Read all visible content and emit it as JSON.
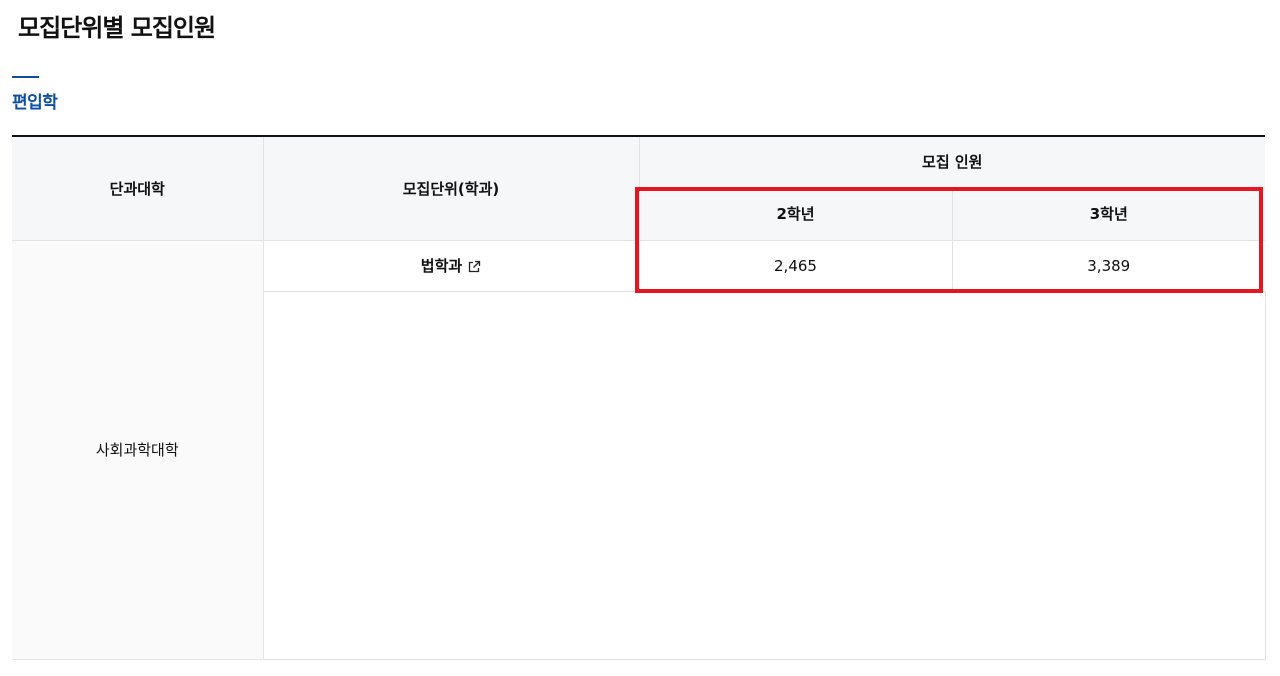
{
  "page": {
    "title": "모집단위별 모집인원"
  },
  "tab": {
    "label": "편입학"
  },
  "table": {
    "headers": {
      "college": "단과대학",
      "unit": "모집단위(학과)",
      "quota": "모집 인원",
      "grade2": "2학년",
      "grade3": "3학년"
    },
    "rows": [
      {
        "college": "사회과학대학",
        "unit": "법학과",
        "grade2": "2,465",
        "grade3": "3,389"
      }
    ]
  },
  "icons": {
    "unit_link": "external-link-icon"
  },
  "colors": {
    "accent": "#0b4ea2",
    "highlight": "#e5161f",
    "header_bg": "#f6f7f9"
  }
}
